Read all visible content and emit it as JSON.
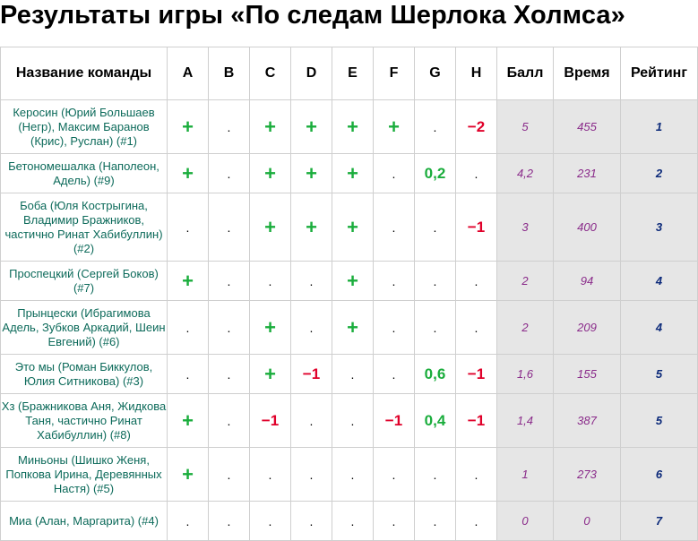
{
  "title": "Результаты игры «По следам Шерлока Холмса»",
  "headers": {
    "team": "Название команды",
    "questions": [
      "A",
      "B",
      "C",
      "D",
      "E",
      "F",
      "G",
      "H"
    ],
    "score": "Балл",
    "time": "Время",
    "rating": "Рейтинг"
  },
  "colors": {
    "plus": "#1aad3c",
    "minus": "#e0002a",
    "team_text": "#0c6a5a",
    "score_text": "#8a2b8a",
    "rating_text": "#0c2a7a",
    "stat_background": "#e6e6e6"
  },
  "rows": [
    {
      "team": "Керосин (Юрий Большаев (Негр), Максим Баранов (Крис), Руслан) (#1)",
      "marks": [
        "+",
        ".",
        "+",
        "+",
        "+",
        "+",
        ".",
        "−2"
      ],
      "score": "5",
      "time": "455",
      "rating": "1"
    },
    {
      "team": "Бетономешалка (Наполеон, Адель) (#9)",
      "marks": [
        "+",
        ".",
        "+",
        "+",
        "+",
        ".",
        "0,2",
        "."
      ],
      "score": "4,2",
      "time": "231",
      "rating": "2"
    },
    {
      "team": "Боба (Юля Кострыгина, Владимир Бражников, частично Ринат Хабибуллин) (#2)",
      "marks": [
        ".",
        ".",
        "+",
        "+",
        "+",
        ".",
        ".",
        "−1"
      ],
      "score": "3",
      "time": "400",
      "rating": "3"
    },
    {
      "team": "Проспецкий (Сергей Боков) (#7)",
      "marks": [
        "+",
        ".",
        ".",
        ".",
        "+",
        ".",
        ".",
        "."
      ],
      "score": "2",
      "time": "94",
      "rating": "4"
    },
    {
      "team": "Прынцески (Ибрагимова Адель, Зубков Аркадий, Шеин Евгений) (#6)",
      "marks": [
        ".",
        ".",
        "+",
        ".",
        "+",
        ".",
        ".",
        "."
      ],
      "score": "2",
      "time": "209",
      "rating": "4"
    },
    {
      "team": "Это мы (Роман Биккулов, Юлия Ситникова) (#3)",
      "marks": [
        ".",
        ".",
        "+",
        "−1",
        ".",
        ".",
        "0,6",
        "−1"
      ],
      "score": "1,6",
      "time": "155",
      "rating": "5"
    },
    {
      "team": "Хз (Бражникова Аня, Жидкова Таня, частично Ринат Хабибуллин) (#8)",
      "marks": [
        "+",
        ".",
        "−1",
        ".",
        ".",
        "−1",
        "0,4",
        "−1"
      ],
      "score": "1,4",
      "time": "387",
      "rating": "5"
    },
    {
      "team": "Миньоны (Шишко Женя, Попкова Ирина, Деревянных Настя) (#5)",
      "marks": [
        "+",
        ".",
        ".",
        ".",
        ".",
        ".",
        ".",
        "."
      ],
      "score": "1",
      "time": "273",
      "rating": "6"
    },
    {
      "team": "Миа (Алан, Маргарита) (#4)",
      "marks": [
        ".",
        ".",
        ".",
        ".",
        ".",
        ".",
        ".",
        "."
      ],
      "score": "0",
      "time": "0",
      "rating": "7"
    }
  ]
}
